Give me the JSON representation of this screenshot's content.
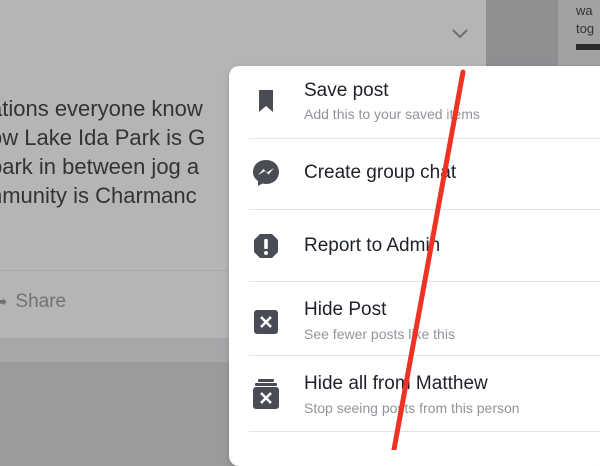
{
  "post": {
    "text_lines": [
      "ations everyone know",
      "ow Lake Ida Park is G",
      "park in between jog a",
      "nmunity is Charmanc"
    ],
    "share_label": "Share"
  },
  "right_preview": {
    "text_lines": [
      "wa",
      "tog"
    ]
  },
  "menu": {
    "items": [
      {
        "label": "Save post",
        "sub": "Add this to your saved items",
        "icon": "bookmark-icon"
      },
      {
        "label": "Create group chat",
        "sub": "",
        "icon": "messenger-icon"
      },
      {
        "label": "Report to Admin",
        "sub": "",
        "icon": "alert-icon"
      },
      {
        "label": "Hide Post",
        "sub": "See fewer posts like this",
        "icon": "hide-icon"
      },
      {
        "label": "Hide all from Matthew",
        "sub": "Stop seeing posts from this person",
        "icon": "hide-all-icon"
      }
    ]
  },
  "colors": {
    "icon": "#494c54",
    "annotation": "#ee3324",
    "overlay": "#b5b5b7"
  }
}
